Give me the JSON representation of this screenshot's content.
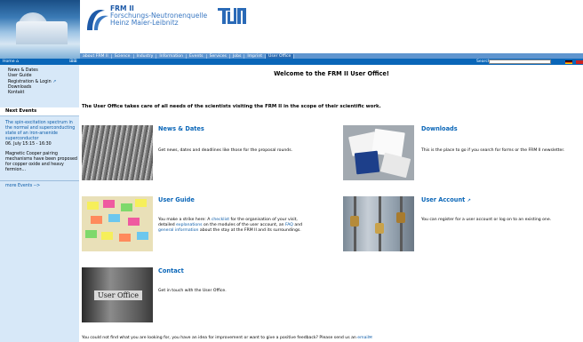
{
  "header": {
    "logo_line1": "FRM II",
    "logo_line2": "Forschungs-Neutronenquelle",
    "logo_line3": "Heinz Maier-Leibnitz",
    "tum_logo": "TUM"
  },
  "topnav": {
    "items": [
      "about FRM II",
      "Science",
      "Industry",
      "Information",
      "Events",
      "Services",
      "Jobs",
      "Imprint",
      "User Office"
    ],
    "active_index": 8
  },
  "bar": {
    "home_label": "Home",
    "search_label": "Search",
    "search_value": ""
  },
  "sidebar": {
    "nav": [
      "News & Dates",
      "User Guide",
      "Registration & Login",
      "Downloads",
      "Kontakt"
    ],
    "events_title": "Next Events",
    "event1_title": "The spin-excitation spectrum in the normal and superconducting state of an iron-arsenide superconductor",
    "event1_date": "06. July 15:15 - 16:30",
    "event2_title": "Magnetic Cooper pairing mechanisms have been proposed for copper oxide and heavy fermion...",
    "more_events": "more Events -->"
  },
  "content": {
    "title": "Welcome to the FRM II User Office!",
    "intro": "The User Office takes care of all needs of the scientists visiting the FRM II in the scope of their scientific work.",
    "news_title": "News & Dates",
    "news_body": "Get news, dates and deadlines like those for the proposal rounds.",
    "guide_title": "User Guide",
    "guide_p1": "You make a strike here: A ",
    "guide_link1": "checklist",
    "guide_p2": " for the organisation of your visit,",
    "guide_p3": "detailed ",
    "guide_link2": "explanations",
    "guide_p4": " on the modules of the user account, an ",
    "guide_link3": "FAQ",
    "guide_p5": " and",
    "guide_link4": "general information",
    "guide_p6": " about the stay at the FRM II and its surroundings.",
    "contact_title": "Contact",
    "contact_body": "Get in touch with the User Office.",
    "contact_image_text": "User Office",
    "downloads_title": "Downloads",
    "downloads_body": "This is the place to go if you search for forms or the FRM II newsletter.",
    "account_title": "User Account",
    "account_body": "You can register for a user account or log on to an existing one.",
    "footer_text": "You could not find what you are looking for, you have an idea for improvement or want to give a positive feedback? Please send us an ",
    "footer_link": "email"
  },
  "colors": {
    "bar_blue": "#0a66b8",
    "topnav_blue": "#5f95cf",
    "sidebar_bg": "#d7e8f8",
    "link": "#0a5ba8"
  },
  "icons": [
    "home-icon",
    "sitemap-icon",
    "external-link-icon",
    "flag-de-icon",
    "flag-en-icon"
  ]
}
